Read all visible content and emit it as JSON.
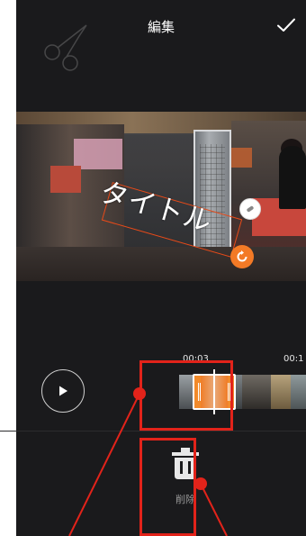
{
  "header": {
    "title": "編集",
    "confirm_icon": "checkmark-icon",
    "decor_icon": "scissors-icon"
  },
  "video": {
    "title_overlay": "タイトル",
    "pin_icon": "pin-icon",
    "rotate_icon": "rotate-icon"
  },
  "timeline": {
    "timestamps": [
      "00:03",
      "00:1"
    ],
    "play_icon": "play-icon"
  },
  "toolbar": {
    "delete_label": "削除",
    "delete_icon": "trash-icon"
  },
  "colors": {
    "background": "#1a1a1c",
    "accent": "#f28a2a",
    "annotation": "#e2231a"
  }
}
